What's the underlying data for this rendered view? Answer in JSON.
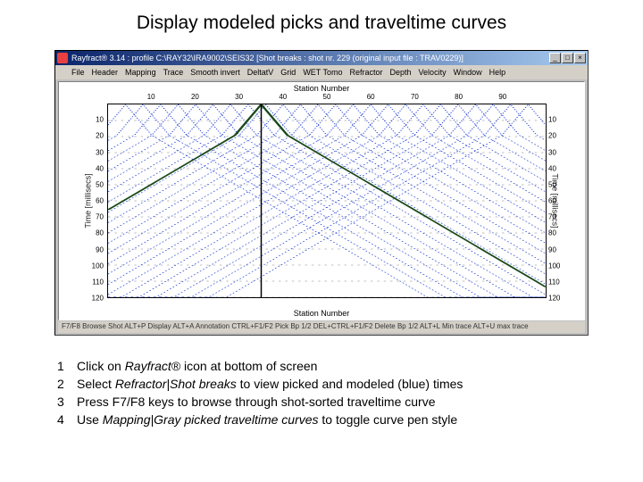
{
  "page_title": "Display modeled picks and traveltime curves",
  "window": {
    "title": "Rayfract® 3.14 : profile C:\\RAY32\\IRA9002\\SEIS32   [Shot breaks : shot nr. 229 (original input file : TRAV0229)]",
    "menu": [
      "File",
      "Header",
      "Mapping",
      "Trace",
      "Smooth invert",
      "DeltatV",
      "Grid",
      "WET Tomo",
      "Refractor",
      "Depth",
      "Velocity",
      "Window",
      "Help"
    ],
    "statusbar": "F7/F8 Browse Shot   ALT+P Display   ALT+A Annotation   CTRL+F1/F2 Pick Bp 1/2   DEL+CTRL+F1/F2 Delete Bp 1/2   ALT+L Min trace   ALT+U max trace"
  },
  "chart_data": {
    "type": "line",
    "title_top": "Station Number",
    "title_bottom": "Station Number",
    "ylabel_left": "Time [millisecs]",
    "ylabel_right": "Time [millisecs]",
    "xlim": [
      0,
      100
    ],
    "ylim": [
      0,
      120
    ],
    "xticks": [
      10,
      20,
      30,
      40,
      50,
      60,
      70,
      80,
      90
    ],
    "yticks": [
      10,
      20,
      30,
      40,
      50,
      60,
      70,
      80,
      90,
      100,
      110,
      120
    ],
    "note": "~24 shot traveltime curves, V-shaped, apex at each shot station (stations ~4 to ~96 step 4), time increasing with distance to ~120 ms at chart edges; plotted as dotted blue; one curve around station 35 highlighted darker/green; vertical marker at station ~35",
    "shot_stations_approx": [
      4,
      8,
      12,
      16,
      20,
      24,
      28,
      32,
      36,
      40,
      44,
      48,
      52,
      56,
      60,
      64,
      68,
      72,
      76,
      80,
      84,
      88,
      92,
      96
    ],
    "marker_station": 35
  },
  "instructions": [
    {
      "pre": "Click on ",
      "em": "Rayfract®",
      "post": " icon at bottom of screen"
    },
    {
      "pre": "Select ",
      "em": "Refractor|Shot breaks",
      "post": " to view picked and modeled (blue) times"
    },
    {
      "pre": "Press F7/F8 keys to browse through shot-sorted traveltime curve",
      "em": "",
      "post": ""
    },
    {
      "pre": "Use ",
      "em": "Mapping|Gray picked traveltime curves",
      "post": " to toggle curve pen style"
    }
  ]
}
